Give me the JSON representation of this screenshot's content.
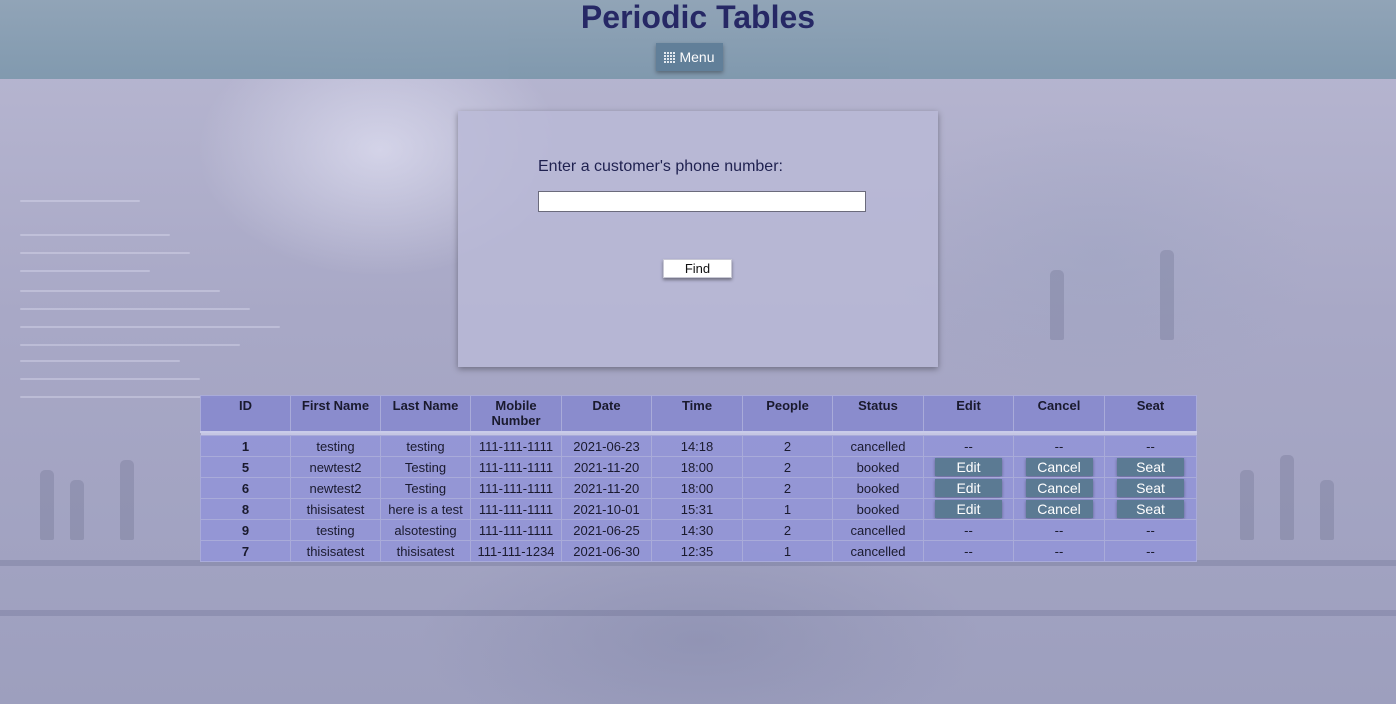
{
  "header": {
    "title": "Periodic Tables",
    "menu_label": "Menu"
  },
  "search": {
    "label": "Enter a customer's phone number:",
    "value": "",
    "placeholder": "",
    "find_label": "Find"
  },
  "table": {
    "columns": [
      "ID",
      "First Name",
      "Last Name",
      "Mobile Number",
      "Date",
      "Time",
      "People",
      "Status",
      "Edit",
      "Cancel",
      "Seat"
    ],
    "rows": [
      {
        "id": "1",
        "first": "testing",
        "last": "testing",
        "mobile": "111-111-1111",
        "date": "2021-06-23",
        "time": "14:18",
        "people": "2",
        "status": "cancelled",
        "edit": "--",
        "cancel": "--",
        "seat": "--"
      },
      {
        "id": "5",
        "first": "newtest2",
        "last": "Testing",
        "mobile": "111-111-1111",
        "date": "2021-11-20",
        "time": "18:00",
        "people": "2",
        "status": "booked",
        "edit": "Edit",
        "cancel": "Cancel",
        "seat": "Seat"
      },
      {
        "id": "6",
        "first": "newtest2",
        "last": "Testing",
        "mobile": "111-111-1111",
        "date": "2021-11-20",
        "time": "18:00",
        "people": "2",
        "status": "booked",
        "edit": "Edit",
        "cancel": "Cancel",
        "seat": "Seat"
      },
      {
        "id": "8",
        "first": "thisisatest",
        "last": "here is a test",
        "mobile": "111-111-1111",
        "date": "2021-10-01",
        "time": "15:31",
        "people": "1",
        "status": "booked",
        "edit": "Edit",
        "cancel": "Cancel",
        "seat": "Seat"
      },
      {
        "id": "9",
        "first": "testing",
        "last": "alsotesting",
        "mobile": "111-111-1111",
        "date": "2021-06-25",
        "time": "14:30",
        "people": "2",
        "status": "cancelled",
        "edit": "--",
        "cancel": "--",
        "seat": "--"
      },
      {
        "id": "7",
        "first": "thisisatest",
        "last": "thisisatest",
        "mobile": "111-111-1234",
        "date": "2021-06-30",
        "time": "12:35",
        "people": "1",
        "status": "cancelled",
        "edit": "--",
        "cancel": "--",
        "seat": "--"
      }
    ]
  },
  "icons": {
    "menu": "grid-icon"
  },
  "colors": {
    "title": "#1f2160",
    "header_bg": "#7e98ad",
    "button_bg": "#5b7a93",
    "table_bg": "#9295d7"
  }
}
